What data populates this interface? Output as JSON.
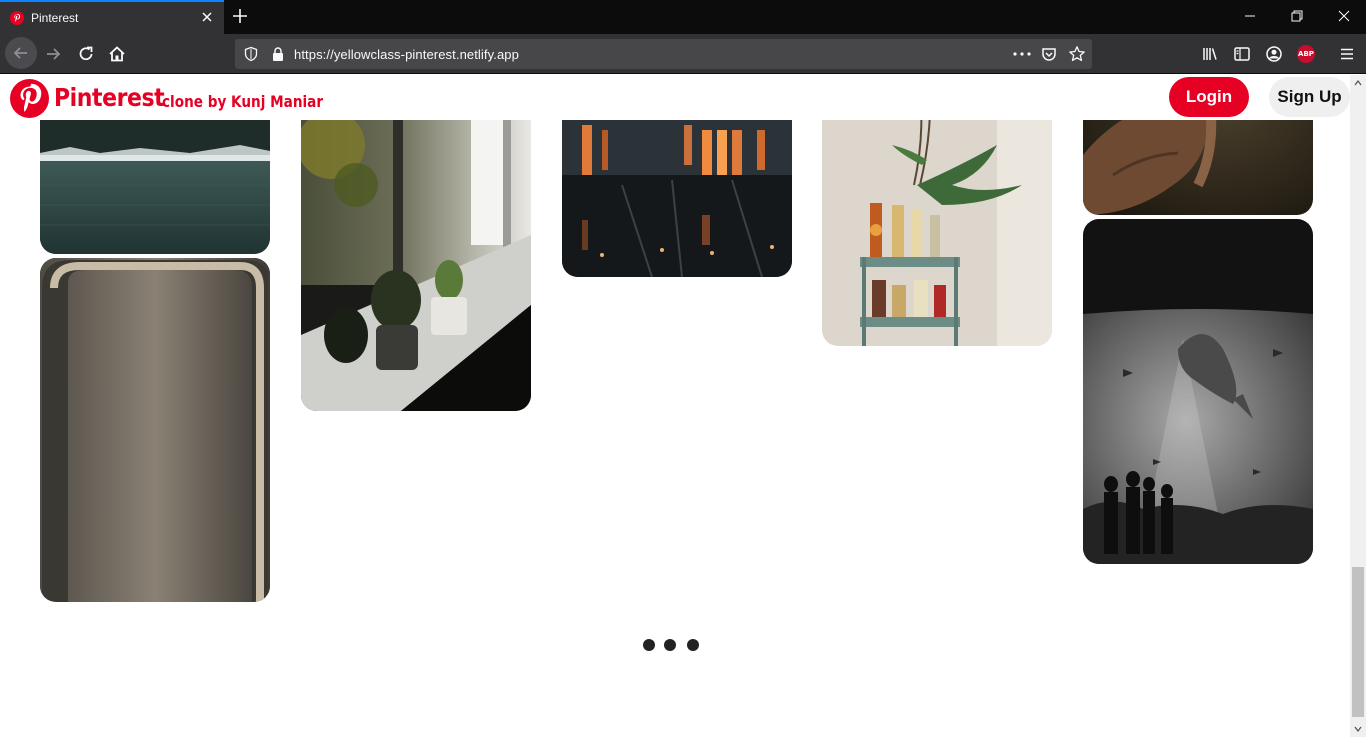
{
  "browser": {
    "tab_title": "Pinterest",
    "url": "https://yellowclass-pinterest.netlify.app",
    "abp_label": "ABP"
  },
  "site": {
    "brand": "Pinterest",
    "subtitle": "clone by Kunj Maniar",
    "login_label": "Login",
    "signup_label": "Sign Up",
    "accent": "#e60023"
  },
  "pins": [
    {
      "name": "lake-forest-pin",
      "subject": "snowy forest lake"
    },
    {
      "name": "city-window-pin",
      "subject": "downtown skyline through window frame"
    },
    {
      "name": "windowsill-plants-pin",
      "subject": "succulents on windowsill"
    },
    {
      "name": "night-reflections-pin",
      "subject": "city lights reflection"
    },
    {
      "name": "bar-cart-pin",
      "subject": "bar cart with bottles and plant"
    },
    {
      "name": "hand-pin",
      "subject": "hand close-up"
    },
    {
      "name": "aquarium-pin",
      "subject": "whale shark aquarium"
    }
  ],
  "loader": {
    "label": "loading-dots"
  }
}
